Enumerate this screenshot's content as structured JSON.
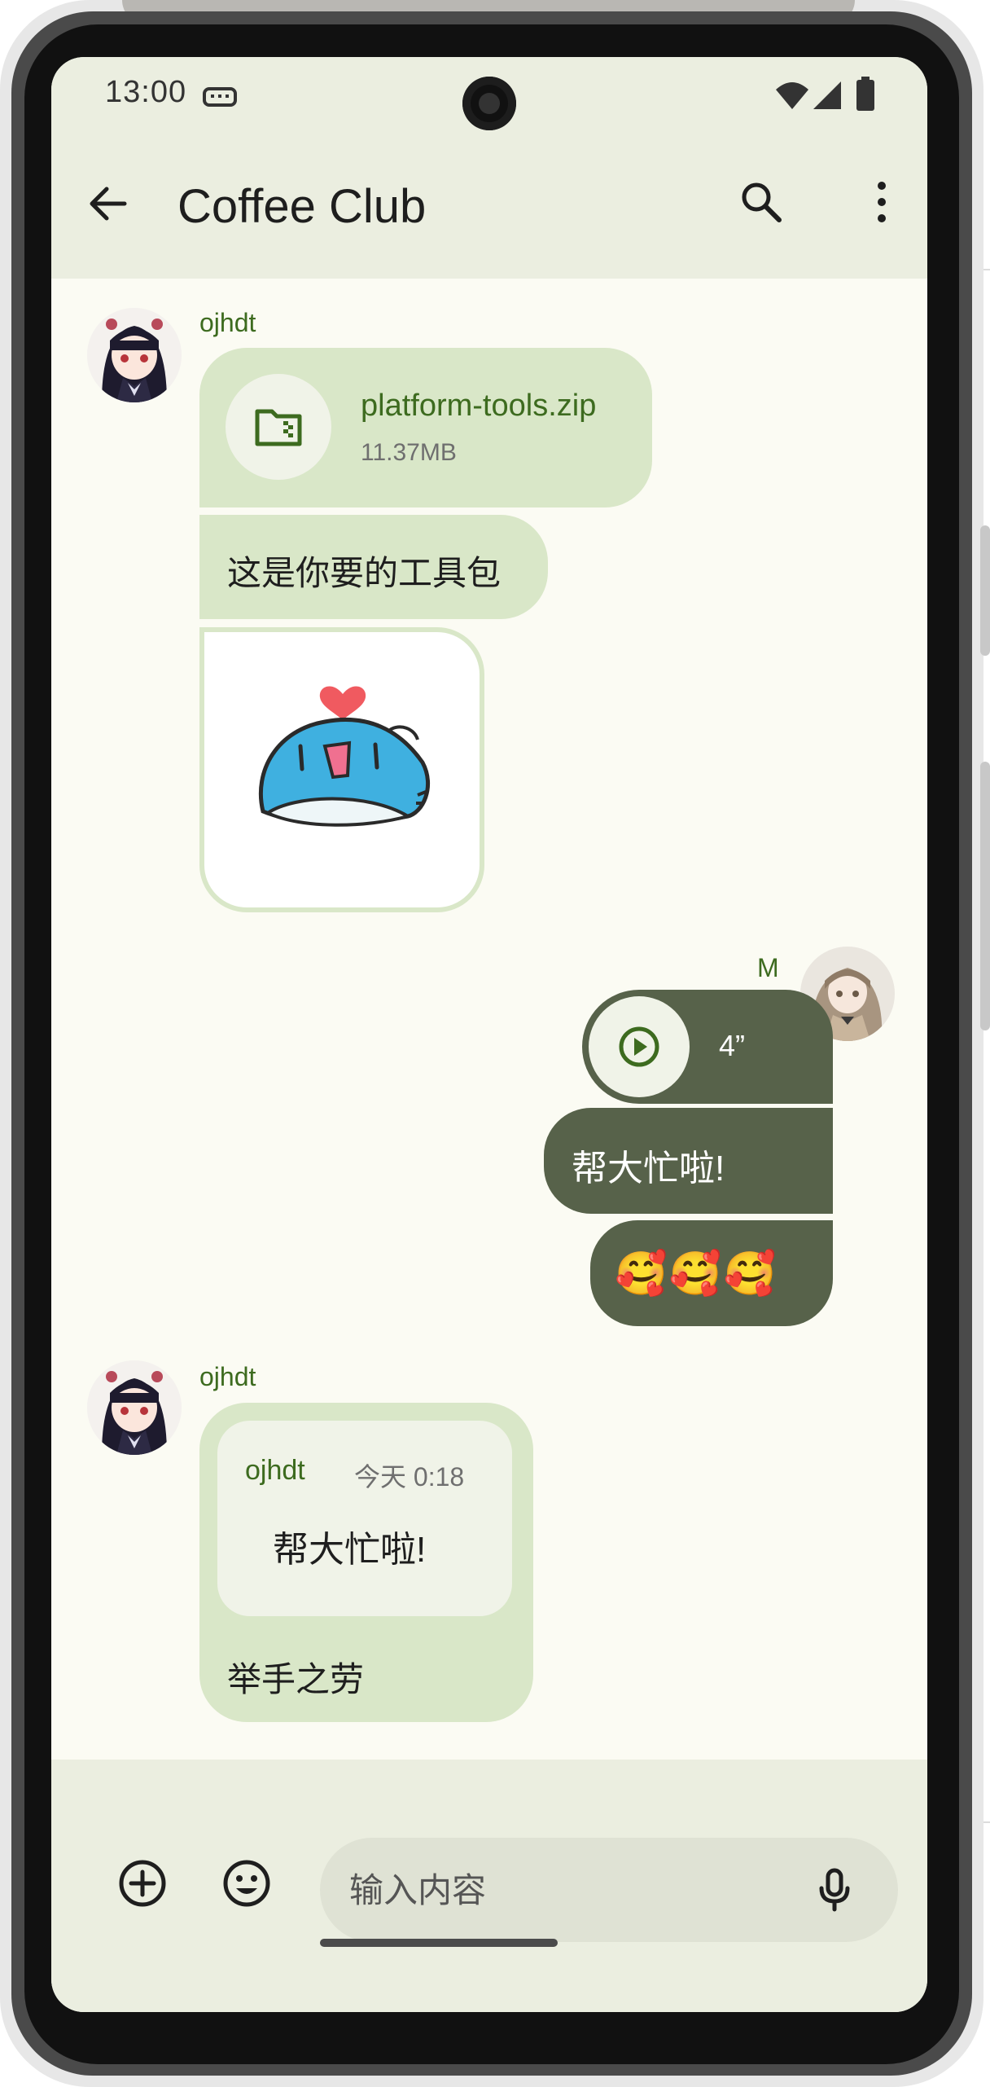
{
  "status_bar": {
    "time": "13:00",
    "icons": [
      "keyboard-icon",
      "wifi-icon",
      "signal-icon",
      "battery-icon"
    ]
  },
  "app_bar": {
    "title": "Coffee Club",
    "icons": [
      "back-arrow-icon",
      "search-icon",
      "more-vert-icon"
    ]
  },
  "messages": [
    {
      "sender": "ojhdt",
      "direction": "incoming",
      "file": {
        "name": "platform-tools.zip",
        "size": "11.37MB",
        "icon": "folder-zip-icon"
      },
      "text": "这是你要的工具包",
      "sticker": "blue-cat-heart-sticker"
    },
    {
      "sender": "M",
      "direction": "outgoing",
      "voice": {
        "duration": "4”",
        "icon": "play-icon"
      },
      "text": "帮大忙啦!",
      "emoji_text": "🥰🥰🥰"
    },
    {
      "sender": "ojhdt",
      "direction": "incoming",
      "quote": {
        "sender": "ojhdt",
        "time": "今天 0:18",
        "text": "帮大忙啦!"
      },
      "text": "举手之劳"
    }
  ],
  "composer": {
    "placeholder": "输入内容",
    "icons": [
      "add-circle-icon",
      "emoji-icon",
      "mic-icon"
    ]
  },
  "colors": {
    "accent_green": "#3d6b1f",
    "incoming_bubble": "#d9e7c8",
    "outgoing_bubble": "#57624a",
    "app_bar_bg": "#ebeee0",
    "chat_bg": "#fbfbf3"
  }
}
